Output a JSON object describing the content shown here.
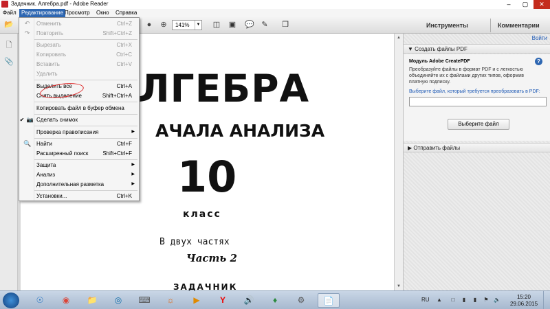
{
  "window": {
    "title": "Задачник. Алгебра.pdf - Adobe Reader",
    "controls": {
      "minimize": "–",
      "maximize": "▢",
      "close": "✕"
    }
  },
  "menubar": {
    "items": [
      {
        "label": "Файл"
      },
      {
        "label": "Редактирование"
      },
      {
        "label": "Просмотр"
      },
      {
        "label": "Окно"
      },
      {
        "label": "Справка"
      }
    ]
  },
  "toolbar": {
    "zoom": "141%",
    "tools_label": "Инструменты",
    "comments_label": "Комментарии",
    "icons": [
      "open-icon",
      "zoom-out-icon",
      "zoom-in-icon",
      "fit-page-icon",
      "fit-width-icon",
      "comment-icon",
      "highlight-icon",
      "sign-icon"
    ]
  },
  "edit_menu": {
    "items": [
      {
        "label": "Отменить",
        "shortcut": "Ctrl+Z",
        "disabled": true,
        "icon": "undo-icon"
      },
      {
        "label": "Повторить",
        "shortcut": "Shift+Ctrl+Z",
        "disabled": true,
        "icon": "redo-icon"
      },
      {
        "label": "Вырезать",
        "shortcut": "Ctrl+X",
        "disabled": true
      },
      {
        "label": "Копировать",
        "shortcut": "Ctrl+C",
        "disabled": true
      },
      {
        "label": "Вставить",
        "shortcut": "Ctrl+V",
        "disabled": true
      },
      {
        "label": "Удалить",
        "shortcut": "",
        "disabled": true
      },
      {
        "label": "Выделить все",
        "shortcut": "Ctrl+A",
        "disabled": false
      },
      {
        "label": "Снять выделение",
        "shortcut": "Shift+Ctrl+A",
        "disabled": false
      },
      {
        "label": "Копировать файл в буфер обмена",
        "shortcut": "",
        "disabled": false
      },
      {
        "label": "Сделать снимок",
        "shortcut": "",
        "disabled": false,
        "checked": true,
        "icon": "camera-icon"
      },
      {
        "label": "Проверка правописания",
        "shortcut": "",
        "disabled": false,
        "submenu": true
      },
      {
        "label": "Найти",
        "shortcut": "Ctrl+F",
        "disabled": false,
        "icon": "search-icon"
      },
      {
        "label": "Расширенный поиск",
        "shortcut": "Shift+Ctrl+F",
        "disabled": false
      },
      {
        "label": "Защита",
        "shortcut": "",
        "disabled": false,
        "submenu": true
      },
      {
        "label": "Анализ",
        "shortcut": "",
        "disabled": false,
        "submenu": true
      },
      {
        "label": "Дополнительная разметка",
        "shortcut": "",
        "disabled": false,
        "submenu": true
      },
      {
        "label": "Установки...",
        "shortcut": "Ctrl+K",
        "disabled": false
      }
    ]
  },
  "document": {
    "title": "ЛГЕБРА",
    "subtitle": "АЧАЛА АНАЛИЗА",
    "grade_number": "10",
    "grade_word": "класс",
    "parts_text": "В двух частях",
    "part_label": "Часть 2",
    "book_type": "ЗАДАЧНИК"
  },
  "right_panel": {
    "login_link": "Войти",
    "create_pdf": {
      "header": "Создать файлы PDF",
      "module_title": "Модуль Adobe CreatePDF",
      "description": "Преобразуйте файлы в формат PDF и с легкостью объединяйте их с файлами других типов, оформив платную подписку.",
      "choose_prompt": "Выберите файл, который требуется преобразовать в PDF:",
      "file_value": "",
      "button_label": "Выберите файл"
    },
    "send_files": {
      "header": "Отправить файлы"
    }
  },
  "taskbar": {
    "apps": [
      "ie-icon",
      "chrome-icon",
      "explorer-icon",
      "hp-icon",
      "devices-icon",
      "firefox-icon",
      "media-icon",
      "yandex-icon",
      "sound-icon",
      "green-icon",
      "tools-icon",
      "document-icon"
    ],
    "language": "RU",
    "time": "15:20",
    "date": "29.06.2015"
  }
}
